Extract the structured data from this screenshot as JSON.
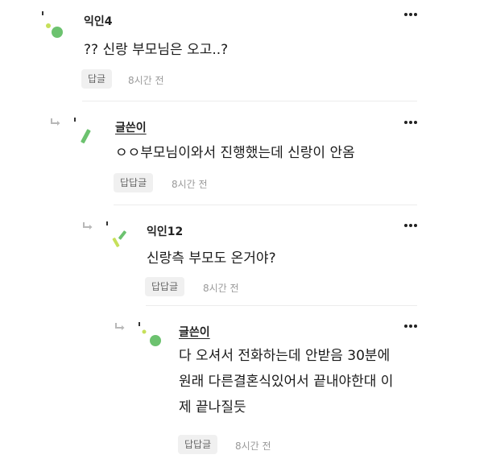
{
  "comments": [
    {
      "author": "익인4",
      "author_is_op": false,
      "avatar_icon": "confetti-avatar-dots",
      "body": "?? 신랑 부모님은 오고..?",
      "reply_label": "답글",
      "time": "8시간 전"
    },
    {
      "author": "글쓴이",
      "author_is_op": true,
      "avatar_icon": "confetti-avatar-stick",
      "body": "ㅇㅇ부모님이와서 진행했는데 신랑이 안옴",
      "reply_label": "답답글",
      "time": "8시간 전"
    },
    {
      "author": "익인12",
      "author_is_op": false,
      "avatar_icon": "confetti-avatar-sticks",
      "body": "신랑측 부모도 온거야?",
      "reply_label": "답답글",
      "time": "8시간 전"
    },
    {
      "author": "글쓴이",
      "author_is_op": true,
      "avatar_icon": "confetti-avatar-dots",
      "body_lines": [
        "다 오셔서 전화하는데 안받음 30분에",
        "원래 다른결혼식있어서 끝내야한대 이",
        "제 끝나질듯"
      ],
      "reply_label": "답답글",
      "time": "8시간 전"
    }
  ],
  "colors": {
    "avatar_green": "#6cc26f",
    "avatar_lime": "#c6e05a",
    "text_primary": "#1a1a1a",
    "muted": "#9a9a9a",
    "button_bg": "#f0f0f0"
  }
}
